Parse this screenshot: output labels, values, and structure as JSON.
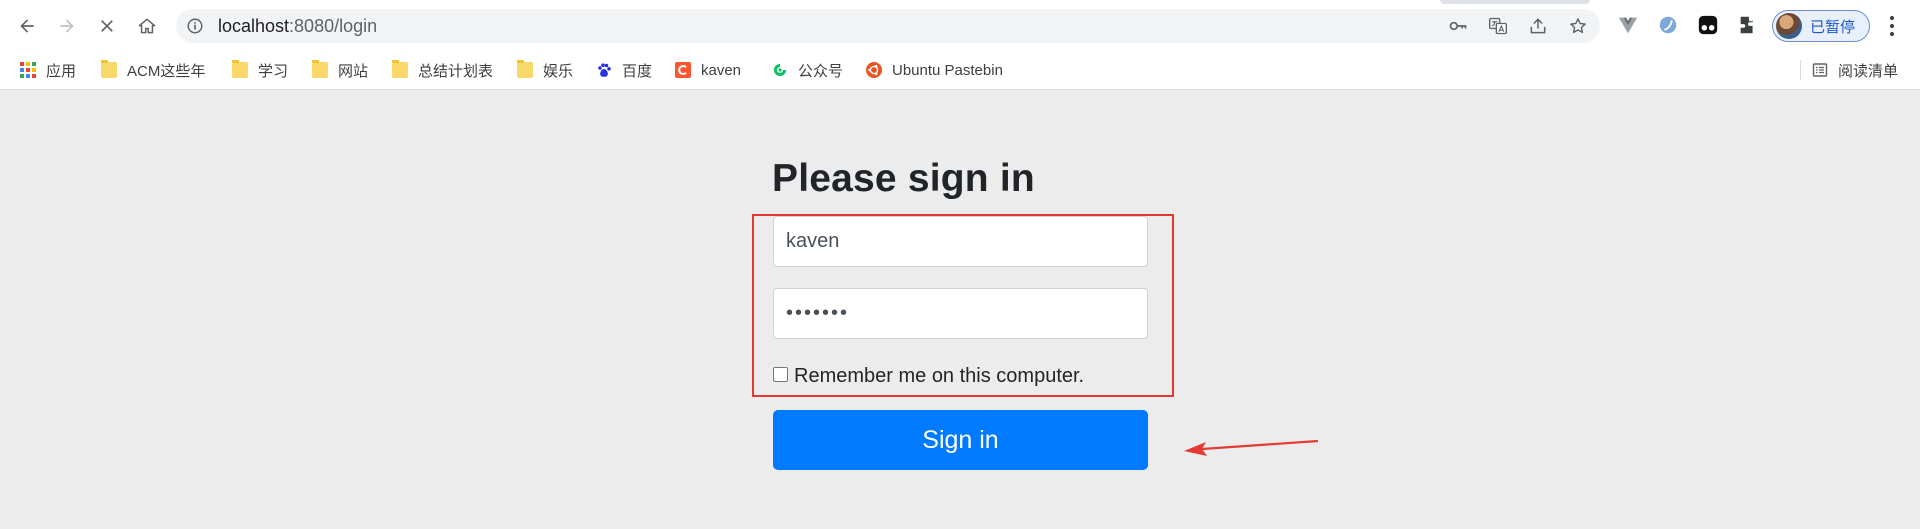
{
  "browser": {
    "url_host": "localhost",
    "url_rest": ":8080/login",
    "profile_label": "已暂停",
    "reading_list_label": "阅读清单"
  },
  "bookmarks": [
    {
      "label": "应用",
      "icon": "apps-grid-icon"
    },
    {
      "label": "ACM这些年",
      "icon": "folder-icon"
    },
    {
      "label": "学习",
      "icon": "folder-icon"
    },
    {
      "label": "网站",
      "icon": "folder-icon"
    },
    {
      "label": "总结计划表",
      "icon": "folder-icon"
    },
    {
      "label": "娱乐",
      "icon": "folder-icon"
    },
    {
      "label": "百度",
      "icon": "baidu-paw-icon"
    },
    {
      "label": "kaven",
      "icon": "csdn-c-icon"
    },
    {
      "label": "公众号",
      "icon": "wechat-swirl-icon"
    },
    {
      "label": "Ubuntu Pastebin",
      "icon": "ubuntu-icon"
    }
  ],
  "form": {
    "heading": "Please sign in",
    "username_value": "kaven",
    "password_value": "•••••••",
    "remember_label": "Remember me on this computer.",
    "remember_checked": false,
    "submit_label": "Sign in"
  },
  "colors": {
    "page_bg": "#ececec",
    "button_primary": "#007bff",
    "annotation_red": "#e53935"
  }
}
